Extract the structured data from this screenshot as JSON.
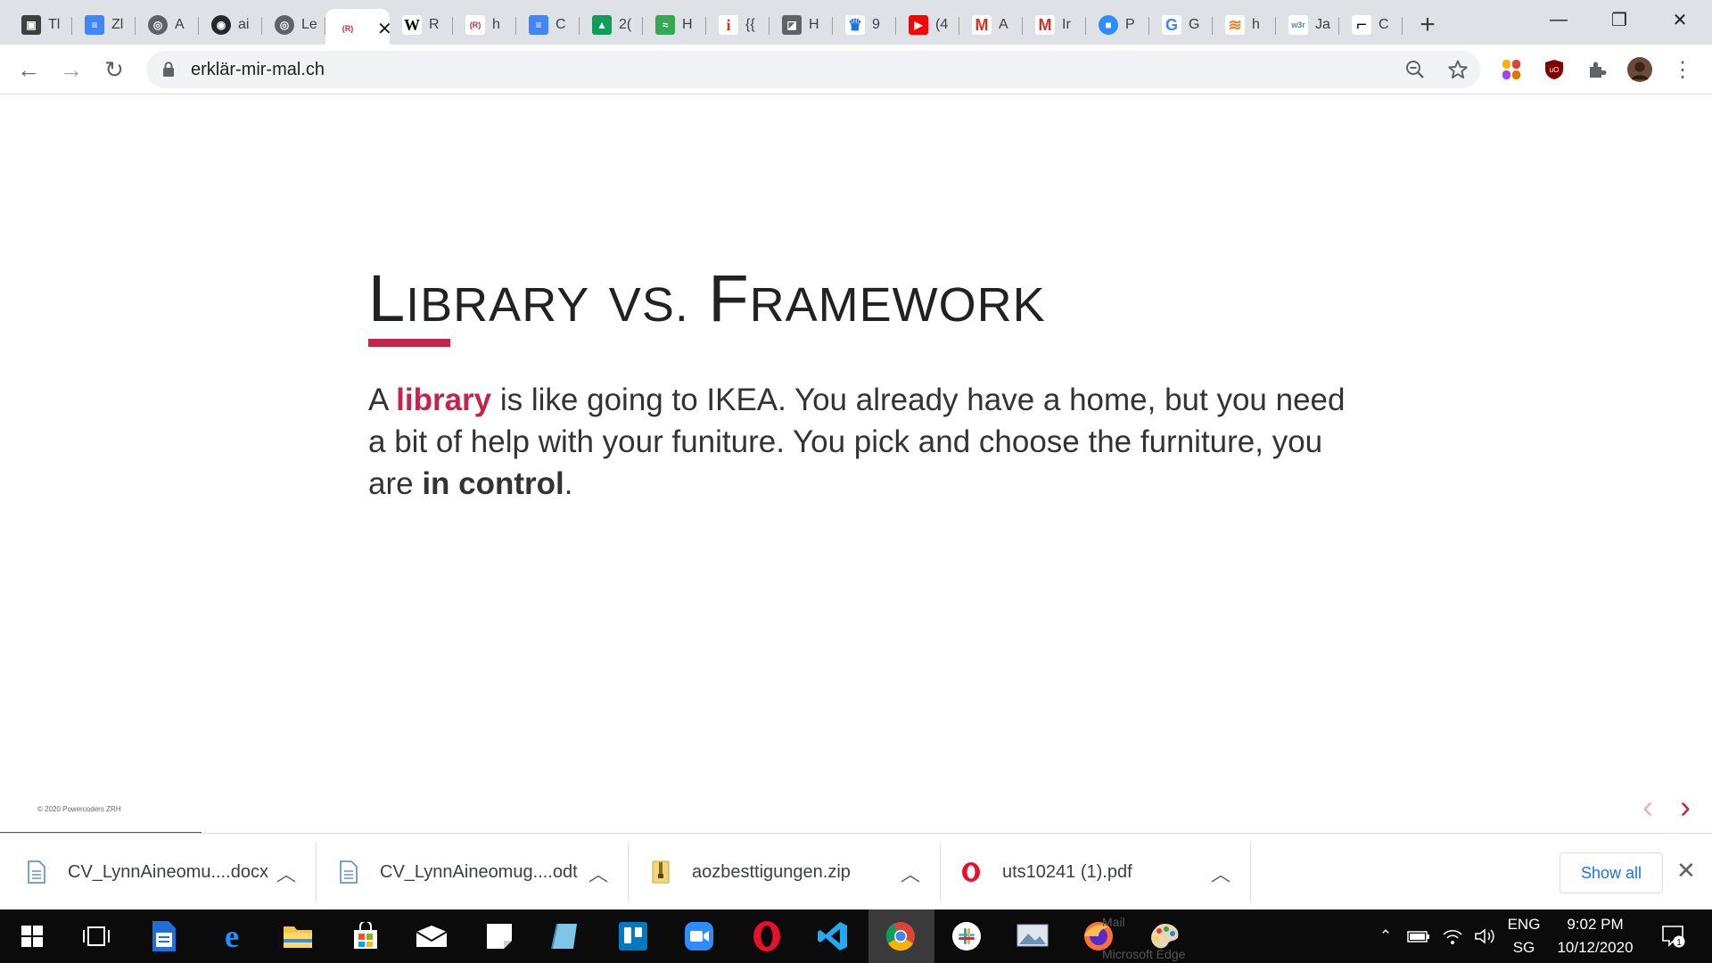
{
  "browser": {
    "tabs": [
      {
        "favicon": "contact-card-icon",
        "label": "Tl"
      },
      {
        "favicon": "google-docs-icon",
        "label": "Zl"
      },
      {
        "favicon": "globe-icon",
        "label": "A"
      },
      {
        "favicon": "github-icon",
        "label": "ai"
      },
      {
        "favicon": "globe-icon",
        "label": "Le"
      },
      {
        "favicon": "rendered-r-icon",
        "label": "",
        "active": true
      },
      {
        "favicon": "wikipedia-icon",
        "label": "R"
      },
      {
        "favicon": "rendered-r-icon",
        "label": "h"
      },
      {
        "favicon": "google-docs-icon",
        "label": "C"
      },
      {
        "favicon": "google-drive-icon",
        "label": "2("
      },
      {
        "favicon": "green-app-icon",
        "label": "H"
      },
      {
        "favicon": "italic-i-icon",
        "label": "{{"
      },
      {
        "favicon": "terminal-icon",
        "label": "H"
      },
      {
        "favicon": "crown-icon",
        "label": "9"
      },
      {
        "favicon": "youtube-icon",
        "label": "(4"
      },
      {
        "favicon": "gmail-icon",
        "label": "A"
      },
      {
        "favicon": "gmail-icon",
        "label": "Ir"
      },
      {
        "favicon": "zoom-icon",
        "label": "P"
      },
      {
        "favicon": "google-icon",
        "label": "G"
      },
      {
        "favicon": "stack-icon",
        "label": "h"
      },
      {
        "favicon": "w3schools-icon",
        "label": "Ja"
      },
      {
        "favicon": "bracket-icon",
        "label": "C"
      }
    ],
    "new_tab_symbol": "+",
    "window_controls": {
      "minimize": "—",
      "restore": "❐",
      "close": "✕"
    },
    "url": "erklär-mir-mal.ch",
    "nav": {
      "back": "←",
      "forward": "→",
      "reload": "↻"
    },
    "zoom_icon": "zoom-out-icon",
    "bookmark_icon": "star-icon"
  },
  "slide": {
    "title_parts": {
      "L": "L",
      "ibrary": "IBRARY",
      "vs": "VS.",
      "F": "F",
      "ramework": "RAMEWORK"
    },
    "body": {
      "p1": "A ",
      "accent": "library",
      "p2": " is like going to IKEA. You already have a home, but you need a bit of help with your funiture. You pick and choose the furniture, you are ",
      "bold": "in control",
      "p3": "."
    },
    "copyright": "© 2020 Powercoders ZRH",
    "prev_arrow": "‹",
    "next_arrow": "›",
    "accent_color": "#c3244c"
  },
  "downloads": {
    "items": [
      {
        "name": "CV_LynnAineomu....docx",
        "icon": "doc-file-icon"
      },
      {
        "name": "CV_LynnAineomug....odt",
        "icon": "doc-file-icon"
      },
      {
        "name": "aozbesttigungen.zip",
        "icon": "zip-file-icon"
      },
      {
        "name": "uts10241 (1).pdf",
        "icon": "opera-pdf-icon"
      }
    ],
    "show_all": "Show all",
    "close": "✕"
  },
  "taskbar": {
    "lang": "ENG",
    "region": "SG",
    "time": "9:02 PM",
    "date": "10/12/2020",
    "notif_count": "1",
    "hidden_label_1": "Mail",
    "hidden_label_2": "Microsoft Edge"
  }
}
